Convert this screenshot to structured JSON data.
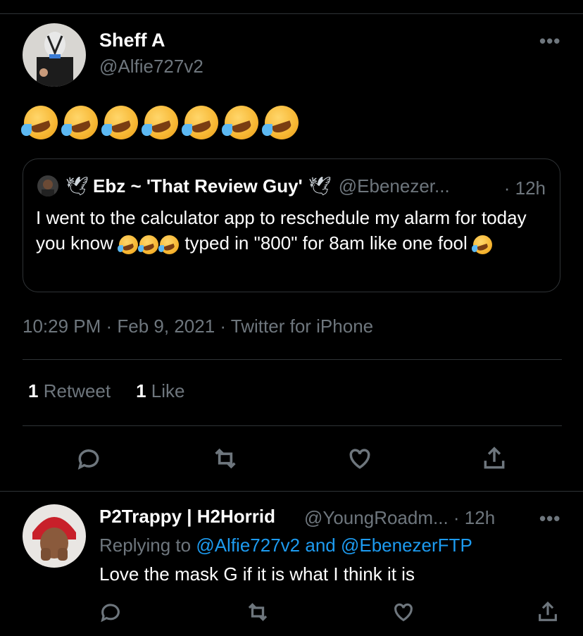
{
  "tweet": {
    "author_name": "Sheff A",
    "author_handle": "@Alfie727v2",
    "more": "•••",
    "emoji_count": 7,
    "timestamp": "10:29 PM · Feb 9, 2021 · Twitter for iPhone",
    "retweets_count": "1",
    "retweets_label": "Retweet",
    "likes_count": "1",
    "likes_label": "Like"
  },
  "quote": {
    "author_name": "Ebz ~ 'That Review Guy'",
    "author_handle": "@Ebenezer...",
    "time": "· 12h",
    "dove": "🕊",
    "text_part1": "I went to the calculator app to reschedule my alarm for today you know",
    "text_part2": "typed in \"800\" for 8am like one fool"
  },
  "reply": {
    "author_name": "P2Trappy | H2Horrid",
    "author_handle": "@YoungRoadm...",
    "time": "· 12h",
    "more": "•••",
    "replying_prefix": "Replying to",
    "replying_user1": "@Alfie727v2",
    "replying_and": "and",
    "replying_user2": "@EbenezerFTP",
    "text": "Love the mask G if it is what I think it is"
  },
  "colors": {
    "background": "#000000",
    "secondary_text": "#6e767d",
    "link": "#1d9bf0",
    "divider": "#2f3336"
  },
  "icons": [
    "reply-icon",
    "retweet-icon",
    "like-icon",
    "share-icon",
    "rolling-on-floor-laughing-emoji",
    "dove-icon"
  ]
}
